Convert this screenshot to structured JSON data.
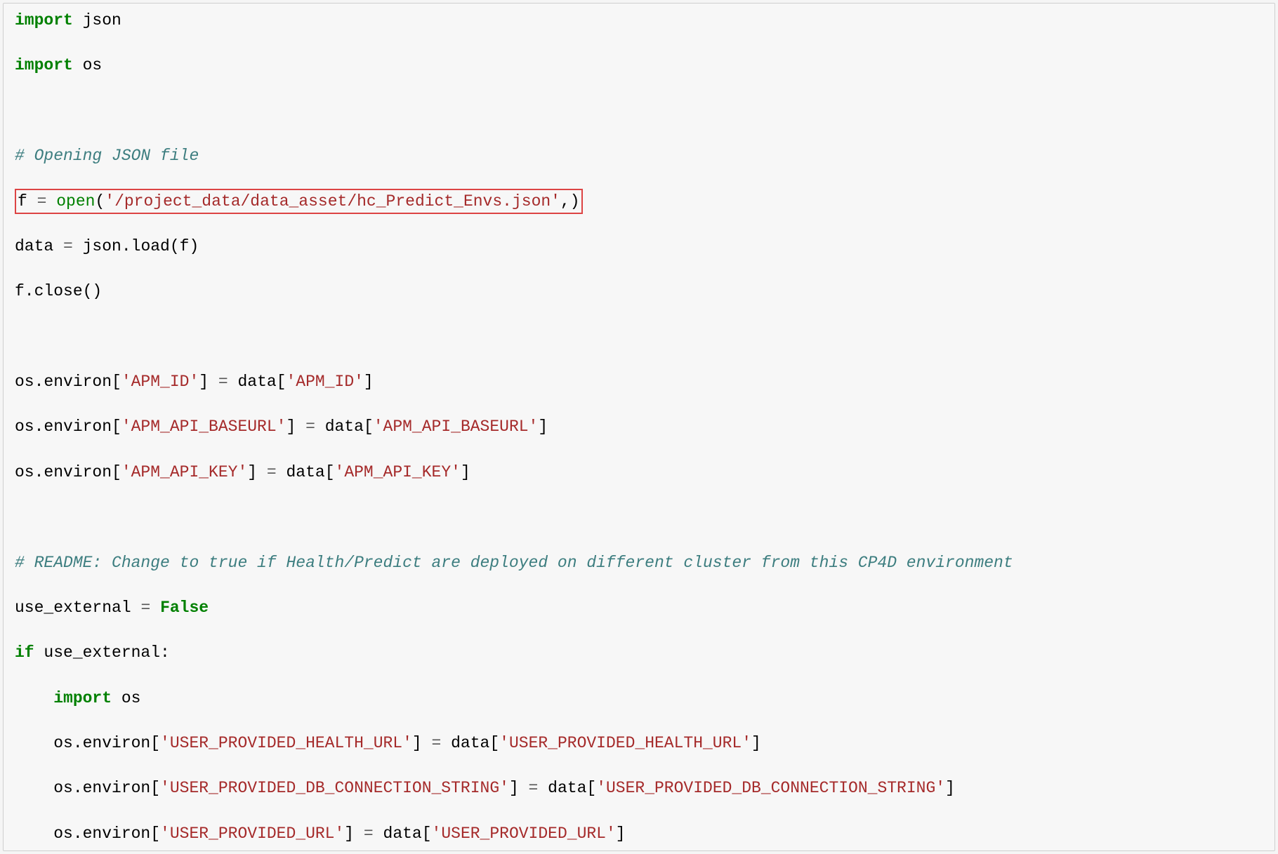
{
  "code": {
    "t01": "import",
    "t02": " json",
    "t03": "import",
    "t04": " os",
    "t05": "# Opening JSON file",
    "t06": "f ",
    "t07": "=",
    "t08": " ",
    "t09": "open",
    "t10": "(",
    "t11": "'/project_data/data_asset/hc_Predict_Envs.json'",
    "t12": ",)",
    "t13": "data ",
    "t14": "=",
    "t15": " json.load(f)",
    "t16": "f.close()",
    "t17": "os.environ[",
    "t18": "'APM_ID'",
    "t19": "] ",
    "t20": "=",
    "t21": " data[",
    "t22": "'APM_ID'",
    "t23": "]",
    "t24": "os.environ[",
    "t25": "'APM_API_BASEURL'",
    "t26": "] ",
    "t27": "=",
    "t28": " data[",
    "t29": "'APM_API_BASEURL'",
    "t30": "]",
    "t31": "os.environ[",
    "t32": "'APM_API_KEY'",
    "t33": "] ",
    "t34": "=",
    "t35": " data[",
    "t36": "'APM_API_KEY'",
    "t37": "]",
    "t38": "# README: Change to true if Health/Predict are deployed on different cluster from this CP4D environment",
    "t39": "use_external ",
    "t40": "=",
    "t41": " ",
    "t42": "False",
    "t43": "if",
    "t44": " use_external:",
    "t45": "    ",
    "t46": "import",
    "t47": " os",
    "t48": "    os.environ[",
    "t49": "'USER_PROVIDED_HEALTH_URL'",
    "t50": "] ",
    "t51": "=",
    "t52": " data[",
    "t53": "'USER_PROVIDED_HEALTH_URL'",
    "t54": "]",
    "t55": "    os.environ[",
    "t56": "'USER_PROVIDED_DB_CONNECTION_STRING'",
    "t57": "] ",
    "t58": "=",
    "t59": " data[",
    "t60": "'USER_PROVIDED_DB_CONNECTION_STRING'",
    "t61": "]",
    "t62": "    os.environ[",
    "t63": "'USER_PROVIDED_URL'",
    "t64": "] ",
    "t65": "=",
    "t66": " data[",
    "t67": "'USER_PROVIDED_URL'",
    "t68": "]"
  },
  "annotation": {
    "target": "open-json-file-line"
  }
}
